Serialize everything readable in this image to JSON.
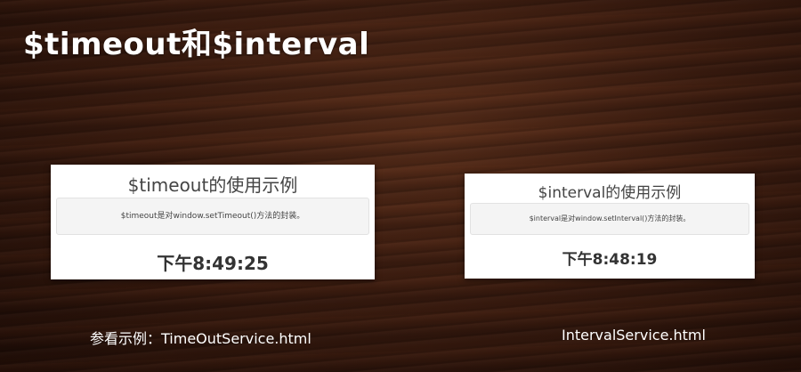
{
  "slide": {
    "title": "$timeout和$interval"
  },
  "timeout_panel": {
    "heading": "$timeout的使用示例",
    "description": "$timeout是对window.setTimeout()方法的封装。",
    "clock": "下午8:49:25"
  },
  "interval_panel": {
    "heading": "$interval的使用示例",
    "description": "$interval是对window.setInterval()方法的封装。",
    "clock": "下午8:48:19"
  },
  "captions": {
    "left": "参看示例：TimeOutService.html",
    "right": "IntervalService.html"
  }
}
